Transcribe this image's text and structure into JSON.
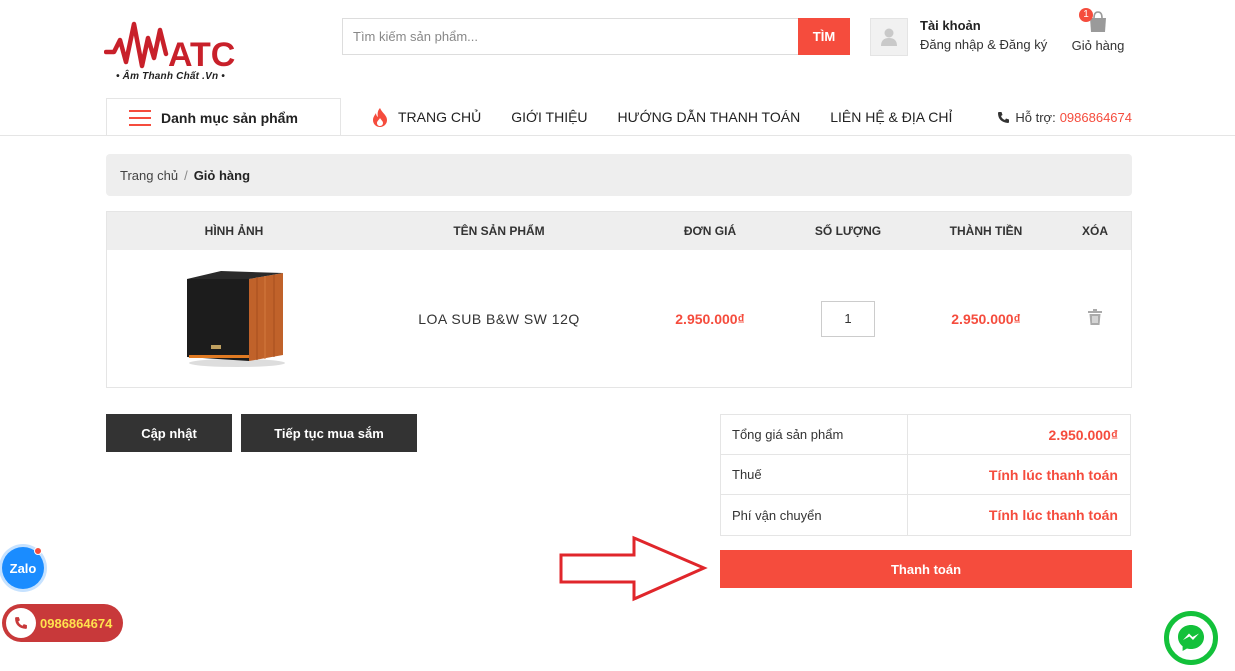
{
  "header": {
    "logo_tagline": "• Âm Thanh Chất .Vn •",
    "search_placeholder": "Tìm kiếm sản phẩm...",
    "search_button": "TÌM",
    "account_title": "Tài khoản",
    "account_sub": "Đăng nhập & Đăng ký",
    "cart_count": "1",
    "cart_label": "Giỏ hàng"
  },
  "nav": {
    "categories_label": "Danh mục sản phẩm",
    "items": [
      {
        "label": "TRANG CHỦ"
      },
      {
        "label": "GIỚI THIỆU"
      },
      {
        "label": "HƯỚNG DẪN THANH TOÁN"
      },
      {
        "label": "LIÊN HỆ & ĐỊA CHỈ"
      }
    ],
    "support_label": "Hỗ trợ:",
    "support_phone": "0986864674"
  },
  "breadcrumb": {
    "home": "Trang chủ",
    "separator": "/",
    "current": "Giỏ hàng"
  },
  "cart_table": {
    "headers": [
      "HÌNH ẢNH",
      "TÊN SẢN PHẨM",
      "ĐƠN GIÁ",
      "SỐ LƯỢNG",
      "THÀNH TIỀN",
      "XÓA"
    ],
    "rows": [
      {
        "name": "LOA SUB B&W SW 12Q",
        "unit_price": "2.950.000₫",
        "quantity": "1",
        "subtotal": "2.950.000₫"
      }
    ]
  },
  "actions": {
    "update": "Cập nhật",
    "continue_shopping": "Tiếp tục mua sắm",
    "checkout": "Thanh toán"
  },
  "totals": {
    "rows": [
      {
        "label": "Tổng giá sản phẩm",
        "value": "2.950.000₫"
      },
      {
        "label": "Thuế",
        "value": "Tính lúc thanh toán"
      },
      {
        "label": "Phí vận chuyển",
        "value": "Tính lúc thanh toán"
      }
    ]
  },
  "widgets": {
    "zalo_label": "Zalo",
    "hotline": "0986864674"
  },
  "colors": {
    "accent": "#f54c3d",
    "dark_button": "#333333",
    "messenger": "#13c13a"
  }
}
